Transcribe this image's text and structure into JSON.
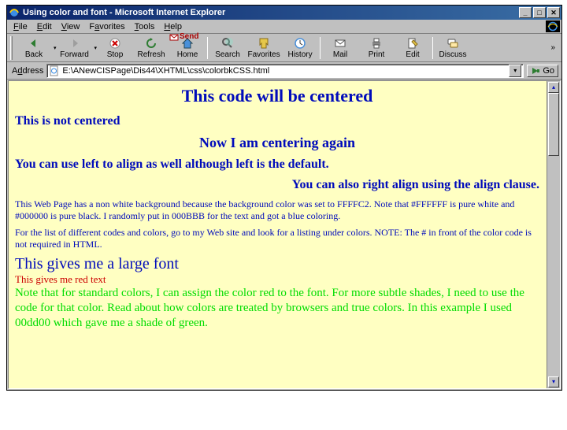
{
  "window": {
    "title": "Using color and font - Microsoft Internet Explorer"
  },
  "menu": {
    "file": "File",
    "edit": "Edit",
    "view": "View",
    "favorites": "Favorites",
    "tools": "Tools",
    "help": "Help"
  },
  "toolbar": {
    "back": "Back",
    "forward": "Forward",
    "stop": "Stop",
    "refresh": "Refresh",
    "home": "Home",
    "search": "Search",
    "favorites": "Favorites",
    "history": "History",
    "mail": "Mail",
    "print": "Print",
    "edit": "Edit",
    "discuss": "Discuss",
    "send_label": "Send"
  },
  "address": {
    "label": "Address",
    "value": "E:\\ANewCISPage\\Dis44\\XHTML\\css\\colorbkCSS.html",
    "go": "Go"
  },
  "page": {
    "h1": "This code will be centered",
    "h2": "This is not centered",
    "h3": "Now I am centering again",
    "h4": "You can use left to align as well although left is the default.",
    "h5": "You can also right align using the align clause.",
    "para1": "This Web Page has a non white background because the background color was set to FFFFC2. Note that #FFFFFF is pure white and #000000 is pure black. I randomly put in 000BBB for the text and got a blue coloring.",
    "para2": "For the list of different codes and colors, go to my Web site and look for a listing under colors. NOTE: The # in front of the color code is not required in HTML.",
    "large": "This gives me a large font",
    "red": "This gives me red text",
    "green": "Note that for standard colors, I can assign the color red to the font. For more subtle shades, I need to use the code for that color. Read about how colors are treated by browsers and true colors. In this example I used 00dd00 which gave me a shade of green."
  },
  "colors": {
    "page_bg": "#ffffc2",
    "page_text": "#000bbb",
    "red": "#cc0000",
    "green": "#00dd00"
  }
}
